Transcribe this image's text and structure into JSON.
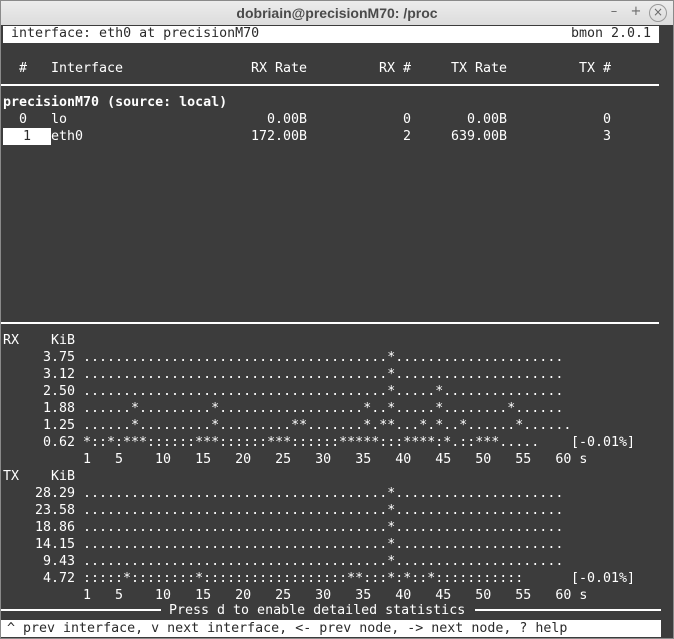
{
  "window": {
    "title": "dobriain@precisionM70: /proc"
  },
  "header": {
    "left": "interface: eth0 at precisionM70",
    "right": "bmon 2.0.1"
  },
  "table": {
    "columns": {
      "num": "#",
      "iface": "Interface",
      "rx_rate": "RX Rate",
      "rx_num": "RX #",
      "tx_rate": "TX Rate",
      "tx_num": "TX #"
    },
    "group": "precisionM70 (source: local)",
    "rows": [
      {
        "num": "0",
        "iface": "lo",
        "rx_rate": "0.00B",
        "rx_num": "0",
        "tx_rate": "0.00B",
        "tx_num": "0"
      },
      {
        "num": "1",
        "iface": "eth0",
        "rx_rate": "172.00B",
        "rx_num": "2",
        "tx_rate": "639.00B",
        "tx_num": "3"
      }
    ]
  },
  "rx_graph": {
    "label": "RX",
    "unit": "KiB",
    "lines": [
      {
        "y": "3.75",
        "bars": "......................................*....................."
      },
      {
        "y": "3.12",
        "bars": "......................................*....................."
      },
      {
        "y": "2.50",
        "bars": "......................................*.....*..............."
      },
      {
        "y": "1.88",
        "bars": "......*.........*..................*..*.....*........*......"
      },
      {
        "y": "1.25",
        "bars": "......*.........*.........**.......*.**...*.*..*......*......"
      },
      {
        "y": "0.62",
        "bars": "*::*:***::::::***::::::***::::::*****:::****:*.::***....."
      }
    ],
    "pct": "[-0.01%]",
    "xaxis": " 1   5    10   15   20   25   30   35   40   45   50   55   60 s"
  },
  "tx_graph": {
    "label": "TX",
    "unit": "KiB",
    "lines": [
      {
        "y": "28.29",
        "bars": "......................................*....................."
      },
      {
        "y": "23.58",
        "bars": "......................................*....................."
      },
      {
        "y": "18.86",
        "bars": "......................................*....................."
      },
      {
        "y": "14.15",
        "bars": "......................................*....................."
      },
      {
        "y": "9.43",
        "bars": "......................................*....................."
      },
      {
        "y": "4.72",
        "bars": ":::::*::::::::*::::::::::::::::::**:::*:*::*:::::::::::"
      }
    ],
    "pct": "[-0.01%]",
    "xaxis": " 1   5    10   15   20   25   30   35   40   45   50   55   60 s"
  },
  "detail_hint": "Press d to enable detailed statistics",
  "status": "^ prev interface, v next interface, <- prev node, -> next node, ? help"
}
